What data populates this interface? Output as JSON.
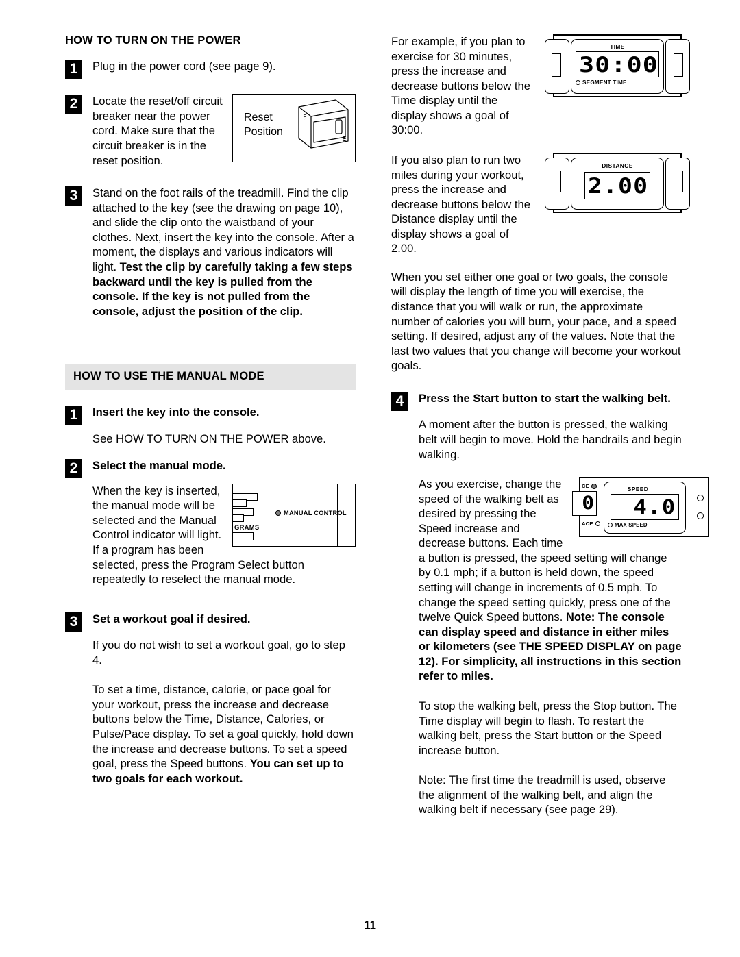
{
  "page": {
    "number": "11"
  },
  "left_column": {
    "heading1": "HOW TO TURN ON THE POWER",
    "step1": {
      "num": "1",
      "text": "Plug in the power cord (see page 9)."
    },
    "step2": {
      "num": "2",
      "text": "Locate the reset/off circuit breaker near the power cord. Make sure that the circuit breaker is in the reset position."
    },
    "step3": {
      "num": "3",
      "text_normal": "Stand on the foot rails of the treadmill. Find the clip attached to the key (see the drawing on page 10), and slide the clip onto the waistband of your clothes. Next, insert the key into the console. After a moment, the displays and various indicators will light. ",
      "text_bold": "Test the clip by carefully taking a few steps backward until the key is pulled from the console. If the key is not pulled from the console, adjust the position of the clip."
    },
    "reset_figure": {
      "label_line1": "Reset",
      "label_line2": "Position"
    },
    "heading2": "HOW TO USE THE MANUAL MODE",
    "manual_step1": {
      "num": "1",
      "title": "Insert the key into the console.",
      "text": "See HOW TO TURN ON THE POWER above."
    },
    "manual_step2": {
      "num": "2",
      "title": "Select the manual mode.",
      "text_part1": "When the key is inserted, the manual mode will be selected and the Manual Control indicator will light. If a program has been",
      "text_part2": "selected, press the Program Select button repeatedly to reselect the manual mode."
    },
    "manual_figure": {
      "indicator_label": "MANUAL CONTROL",
      "grams_label": "GRAMS"
    },
    "manual_step3": {
      "num": "3",
      "title": "Set a workout goal if desired.",
      "text1": "If you do not wish to set a workout goal, go to step 4.",
      "text2_normal": "To set a time, distance, calorie, or pace goal for your workout, press the increase and decrease buttons below the Time, Distance, Calories, or Pulse/Pace display. To set a goal quickly, hold down the increase and decrease buttons. To set a speed goal, press the Speed buttons. ",
      "text2_bold": "You can set up to two goals for each workout."
    }
  },
  "right_column": {
    "para1": "For example, if you plan to exercise for 30 minutes, press the increase and decrease buttons below the Time display until the display shows a goal of  30:00.",
    "para2": "If you also plan to run two miles during your workout, press the increase and decrease buttons below the Distance display until the display shows a goal of  2.00.",
    "para3": "When you set either one goal or two goals, the console will display the length of time you will exercise, the distance that you will walk or run, the approximate number of calories you will burn, your pace, and a speed setting. If desired, adjust any of the values. Note that the last two values that you change will become your workout goals.",
    "step4": {
      "num": "4",
      "title": "Press the Start button to start the walking belt.",
      "para_a": "A moment after the button is pressed, the walking belt will begin to move. Hold the handrails and begin walking.",
      "para_b_normal": "As you exercise, change the speed of the walking belt as desired by pressing the Speed increase and decrease buttons. Each time a button is pressed, the speed setting will change by 0.1 mph; if a button is held down, the speed setting will change in increments of 0.5 mph. To change the speed setting quickly, press one of the twelve Quick Speed buttons. ",
      "para_b_bold": "Note: The console can display speed and distance in either miles or kilometers (see THE SPEED DISPLAY on page 12). For simplicity, all  instructions in this section refer to miles.",
      "para_c": "To stop the walking belt, press the Stop button. The Time display will begin to flash. To restart the walking belt, press the Start button or the Speed increase button.",
      "para_d": "Note: The first time the treadmill is used, observe the alignment of the walking belt, and align the walking belt if necessary (see page 29)."
    },
    "time_figure": {
      "title": "TIME",
      "value": "30:00",
      "sub_label": "SEGMENT TIME"
    },
    "distance_figure": {
      "title": "DISTANCE",
      "value": "2.00"
    },
    "speed_figure": {
      "title": "SPEED",
      "value": "4.0",
      "sub_label": "MAX SPEED",
      "left_label_top": "CE",
      "left_label_bottom": "ACE",
      "left_value": "0"
    }
  }
}
